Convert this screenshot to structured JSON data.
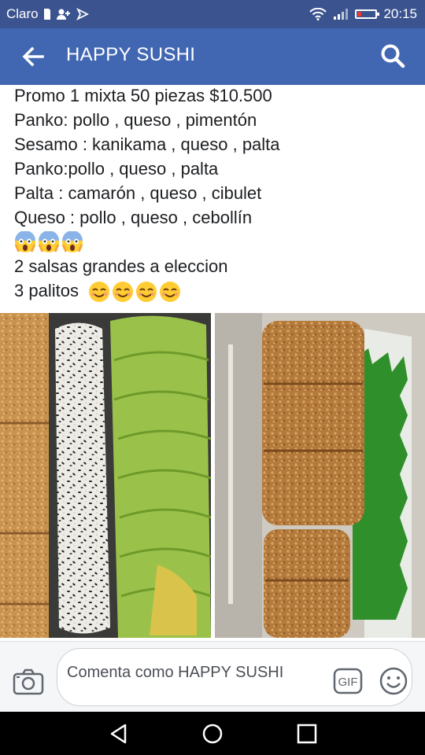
{
  "status_bar": {
    "carrier": "Claro",
    "time": "20:15"
  },
  "app_bar": {
    "title": "HAPPY SUSHI"
  },
  "post": {
    "lines": [
      "Promo 1 mixta 50 piezas $10.500",
      "Panko: pollo , queso , pimentón",
      "Sesamo : kanikama , queso , palta",
      "Panko:pollo , queso , palta",
      "Palta : camarón , queso , cibulet",
      "Queso : pollo , queso , cebollín",
      "2 salsas grandes a eleccion",
      "3 palitos"
    ],
    "emoji_row": [
      "screaming-face",
      "screaming-face",
      "screaming-face"
    ],
    "palitos_emojis": [
      "smiling-face",
      "smiling-face",
      "smiling-face",
      "smiling-face"
    ]
  },
  "comment": {
    "placeholder": "Comenta como HAPPY SUSHI",
    "gif_label": "GIF"
  },
  "colors": {
    "status_bar": "#3b5490",
    "app_bar": "#4267b2",
    "text": "#1c1e21"
  }
}
